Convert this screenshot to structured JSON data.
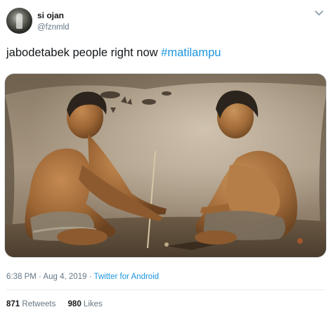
{
  "user": {
    "display_name": "si ojan",
    "handle": "@fznmld"
  },
  "tweet": {
    "text": "jabodetabek people right now ",
    "hashtag": "#matilampu"
  },
  "meta": {
    "time": "6:38 PM",
    "separator": " · ",
    "date": "Aug 4, 2019",
    "separator2": " · ",
    "source": "Twitter for Android"
  },
  "stats": {
    "retweets_count": "871",
    "retweets_label": "Retweets",
    "likes_count": "980",
    "likes_label": "Likes"
  },
  "icons": {
    "menu": "chevron-down-icon"
  },
  "colors": {
    "link": "#1b95e0",
    "secondary_text": "#657786",
    "primary_text": "#14171a"
  }
}
